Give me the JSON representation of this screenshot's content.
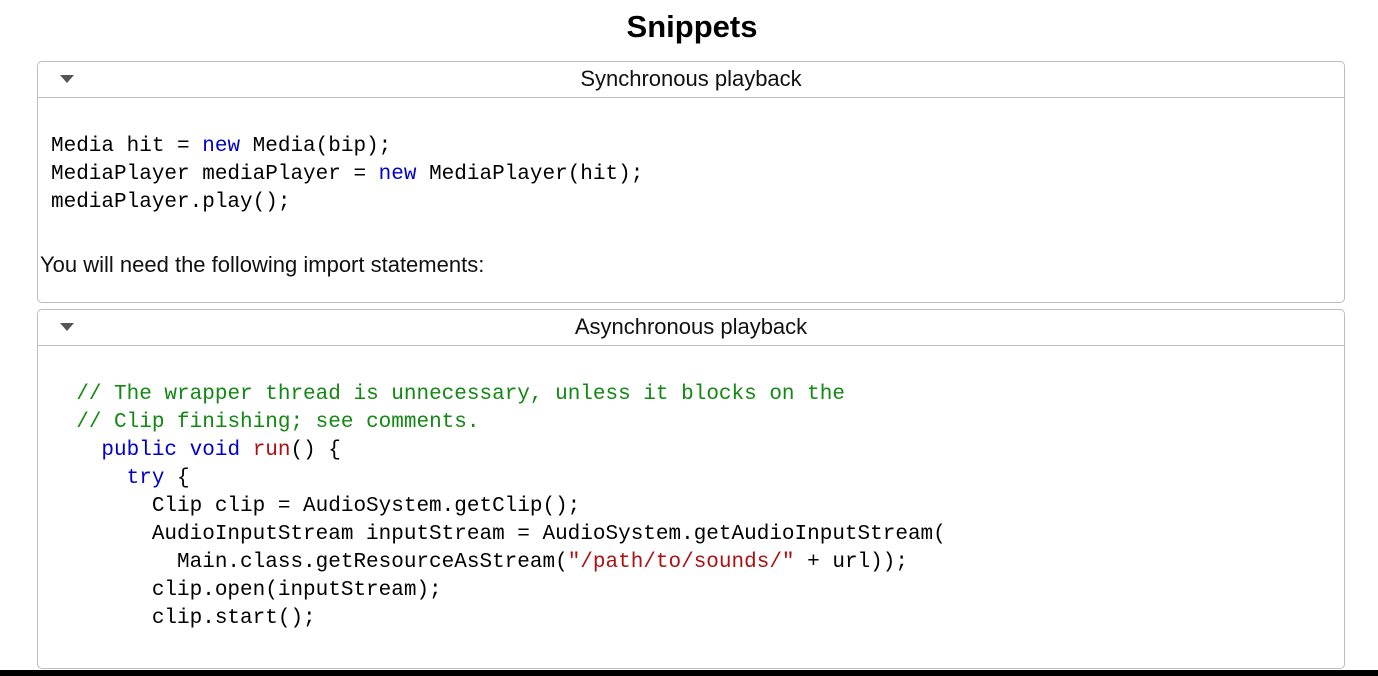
{
  "page": {
    "title": "Snippets"
  },
  "panels": {
    "sync": {
      "title": "Synchronous playback",
      "code": [
        [
          {
            "t": "Media hit = ",
            "c": ""
          },
          {
            "t": "new",
            "c": "kw"
          },
          {
            "t": " Media(bip);",
            "c": ""
          }
        ],
        [
          {
            "t": "MediaPlayer mediaPlayer = ",
            "c": ""
          },
          {
            "t": "new",
            "c": "kw"
          },
          {
            "t": " MediaPlayer(hit);",
            "c": ""
          }
        ],
        [
          {
            "t": "mediaPlayer.play();",
            "c": ""
          }
        ]
      ],
      "note": "You will need the following import statements:"
    },
    "async": {
      "title": "Asynchronous playback",
      "code": [
        [
          {
            "t": "  ",
            "c": ""
          },
          {
            "t": "// The wrapper thread is unnecessary, unless it blocks on the",
            "c": "cm"
          }
        ],
        [
          {
            "t": "  ",
            "c": ""
          },
          {
            "t": "// Clip finishing; see comments.",
            "c": "cm"
          }
        ],
        [
          {
            "t": "    ",
            "c": ""
          },
          {
            "t": "public",
            "c": "kw"
          },
          {
            "t": " ",
            "c": ""
          },
          {
            "t": "void",
            "c": "kw"
          },
          {
            "t": " ",
            "c": ""
          },
          {
            "t": "run",
            "c": "fn"
          },
          {
            "t": "() {",
            "c": ""
          }
        ],
        [
          {
            "t": "      ",
            "c": ""
          },
          {
            "t": "try",
            "c": "kw"
          },
          {
            "t": " {",
            "c": ""
          }
        ],
        [
          {
            "t": "        Clip clip = AudioSystem.getClip();",
            "c": ""
          }
        ],
        [
          {
            "t": "        AudioInputStream inputStream = AudioSystem.getAudioInputStream(",
            "c": ""
          }
        ],
        [
          {
            "t": "          Main.class.getResourceAsStream(",
            "c": ""
          },
          {
            "t": "\"/path/to/sounds/\"",
            "c": "str"
          },
          {
            "t": " + url));",
            "c": ""
          }
        ],
        [
          {
            "t": "        clip.open(inputStream);",
            "c": ""
          }
        ],
        [
          {
            "t": "        clip.start();",
            "c": ""
          }
        ]
      ]
    }
  },
  "colors": {
    "keyword": "#0000cc",
    "comment": "#118811",
    "string": "#aa1111",
    "panel_border": "#bdbdbd"
  },
  "icons": {
    "panel_toggle": "triangle-down-icon"
  }
}
